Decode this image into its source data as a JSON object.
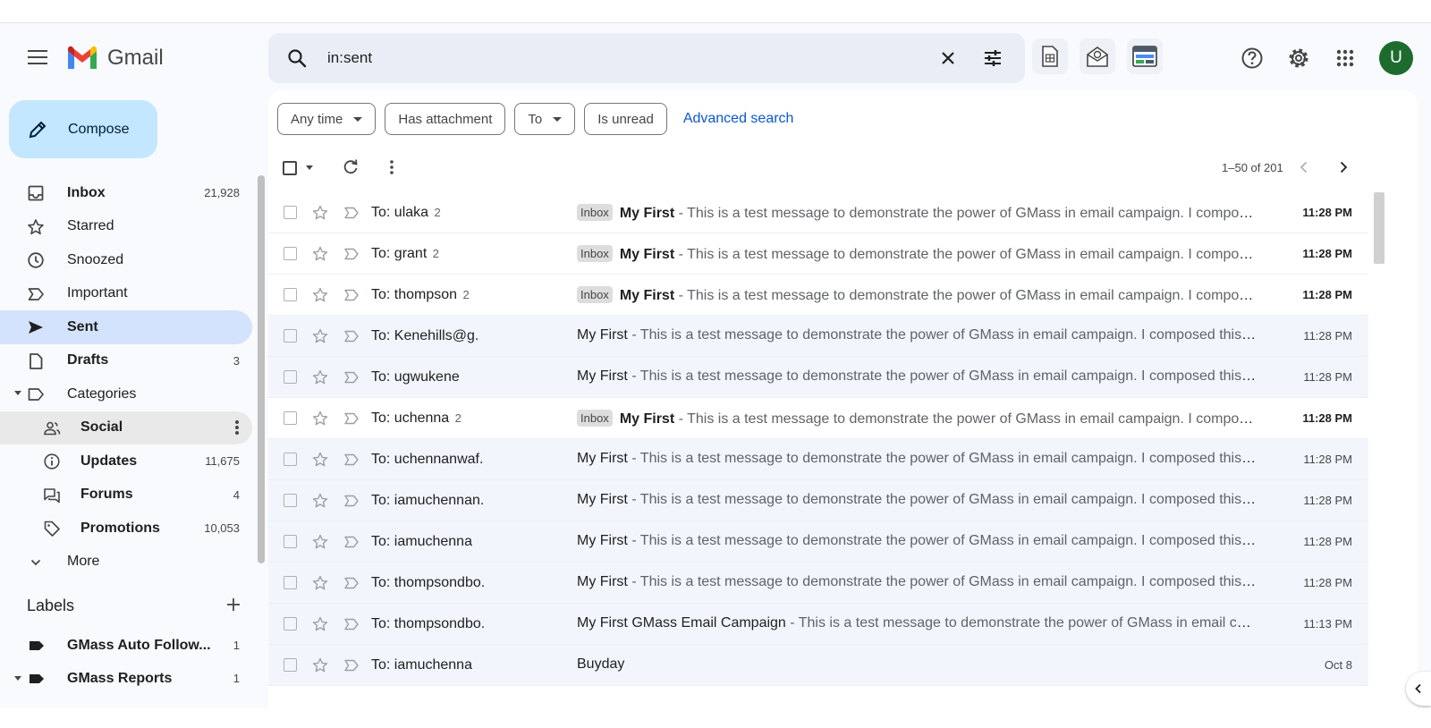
{
  "app": {
    "name": "Gmail",
    "avatar_letter": "U",
    "accent": "#0b57d0",
    "compose_color": "#c2e7ff",
    "selected_color": "#d3e3fd",
    "avatar_color": "#1e6b2e"
  },
  "search": {
    "value": "in:sent"
  },
  "compose": {
    "label": "Compose"
  },
  "nav": [
    {
      "label": "Inbox",
      "count": "21,928",
      "icon": "inbox-icon",
      "bold": true
    },
    {
      "label": "Starred",
      "count": "",
      "icon": "star-icon",
      "bold": false
    },
    {
      "label": "Snoozed",
      "count": "",
      "icon": "clock-icon",
      "bold": false
    },
    {
      "label": "Important",
      "count": "",
      "icon": "important-icon",
      "bold": false
    },
    {
      "label": "Sent",
      "count": "",
      "icon": "send-icon",
      "bold": true,
      "selected": true
    },
    {
      "label": "Drafts",
      "count": "3",
      "icon": "draft-icon",
      "bold": true
    },
    {
      "label": "Categories",
      "count": "",
      "icon": "label-outline-icon",
      "bold": false
    },
    {
      "label": "Social",
      "count": "",
      "icon": "people-icon",
      "bold": true
    },
    {
      "label": "Updates",
      "count": "11,675",
      "icon": "info-icon",
      "bold": true
    },
    {
      "label": "Forums",
      "count": "4",
      "icon": "forum-icon",
      "bold": true
    },
    {
      "label": "Promotions",
      "count": "10,053",
      "icon": "tag-icon",
      "bold": true
    },
    {
      "label": "More",
      "count": "",
      "icon": "chevron-down-icon",
      "bold": false
    }
  ],
  "labels": {
    "title": "Labels",
    "items": [
      {
        "name": "GMass Auto Follow...",
        "count": "1"
      },
      {
        "name": "GMass Reports",
        "count": "1"
      }
    ]
  },
  "filters": {
    "any_time": "Any time",
    "has_attachment": "Has attachment",
    "to": "To",
    "is_unread": "Is unread",
    "advanced_search": "Advanced search"
  },
  "pager": {
    "text": "1–50 of 201"
  },
  "emails": [
    {
      "to": "To: ulaka",
      "count": "2",
      "badge": "Inbox",
      "subject": "My First",
      "snippet": " - This is a test message to demonstrate the power of GMass in email campaign. I composed this email",
      "time": "11:28 PM",
      "unread": true
    },
    {
      "to": "To: grant",
      "count": "2",
      "badge": "Inbox",
      "subject": "My First",
      "snippet": " - This is a test message to demonstrate the power of GMass in email campaign. I composed this email",
      "time": "11:28 PM",
      "unread": true
    },
    {
      "to": "To: thompson",
      "count": "2",
      "badge": "Inbox",
      "subject": "My First",
      "snippet": " - This is a test message to demonstrate the power of GMass in email campaign. I composed this email",
      "time": "11:28 PM",
      "unread": true
    },
    {
      "to": "To: Kenehills@g.",
      "count": "",
      "badge": "",
      "subject": "My First",
      "snippet": " - This is a test message to demonstrate the power of GMass in email campaign. I composed this email",
      "time": "11:28 PM",
      "unread": false
    },
    {
      "to": "To: ugwukene",
      "count": "",
      "badge": "",
      "subject": "My First",
      "snippet": " - This is a test message to demonstrate the power of GMass in email campaign. I composed this email",
      "time": "11:28 PM",
      "unread": false
    },
    {
      "to": "To: uchenna",
      "count": "2",
      "badge": "Inbox",
      "subject": "My First",
      "snippet": " - This is a test message to demonstrate the power of GMass in email campaign. I composed this email",
      "time": "11:28 PM",
      "unread": true
    },
    {
      "to": "To: uchennanwaf.",
      "count": "",
      "badge": "",
      "subject": "My First",
      "snippet": " - This is a test message to demonstrate the power of GMass in email campaign. I composed this email",
      "time": "11:28 PM",
      "unread": false
    },
    {
      "to": "To: iamuchennan.",
      "count": "",
      "badge": "",
      "subject": "My First",
      "snippet": " - This is a test message to demonstrate the power of GMass in email campaign. I composed this email",
      "time": "11:28 PM",
      "unread": false
    },
    {
      "to": "To: iamuchenna",
      "count": "",
      "badge": "",
      "subject": "My First",
      "snippet": " - This is a test message to demonstrate the power of GMass in email campaign. I composed this email",
      "time": "11:28 PM",
      "unread": false
    },
    {
      "to": "To: thompsondbo.",
      "count": "",
      "badge": "",
      "subject": "My First",
      "snippet": " - This is a test message to demonstrate the power of GMass in email campaign. I composed this email",
      "time": "11:28 PM",
      "unread": false
    },
    {
      "to": "To: thompsondbo.",
      "count": "",
      "badge": "",
      "subject": "My First GMass Email Campaign",
      "snippet": " - This is a test message to demonstrate the power of GMass in email campaign",
      "time": "11:13 PM",
      "unread": false
    },
    {
      "to": "To: iamuchenna",
      "count": "",
      "badge": "",
      "subject": "Buyday",
      "snippet": "",
      "time": "Oct 8",
      "unread": false
    }
  ]
}
